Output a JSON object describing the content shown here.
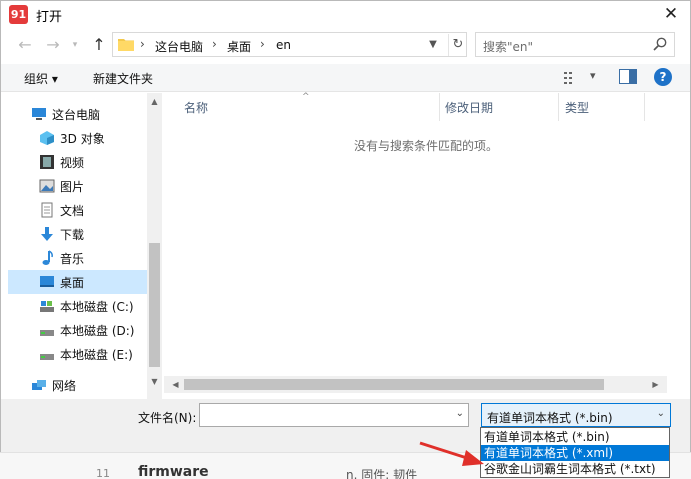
{
  "dialog": {
    "title": "打开",
    "app_icon_text": "91",
    "close_symbol": "✕"
  },
  "address": {
    "crumbs": [
      "这台电脑",
      "桌面",
      "en"
    ],
    "separator": "›"
  },
  "search": {
    "placeholder": "搜索\"en\""
  },
  "toolbar": {
    "organize": "组织 ▾",
    "new_folder": "新建文件夹",
    "view_label": "▾"
  },
  "nav": {
    "items": [
      {
        "label": "这台电脑",
        "icon": "computer-icon"
      },
      {
        "label": "3D 对象",
        "icon": "3d-objects-icon"
      },
      {
        "label": "视频",
        "icon": "video-icon"
      },
      {
        "label": "图片",
        "icon": "pictures-icon"
      },
      {
        "label": "文档",
        "icon": "documents-icon"
      },
      {
        "label": "下载",
        "icon": "download-icon"
      },
      {
        "label": "音乐",
        "icon": "music-icon"
      },
      {
        "label": "桌面",
        "icon": "desktop-icon",
        "selected": true
      },
      {
        "label": "本地磁盘 (C:)",
        "icon": "drive-c-icon"
      },
      {
        "label": "本地磁盘 (D:)",
        "icon": "drive-icon"
      },
      {
        "label": "本地磁盘 (E:)",
        "icon": "drive-icon"
      },
      {
        "label": "网络",
        "icon": "network-icon"
      }
    ]
  },
  "filelist": {
    "columns": [
      "名称",
      "修改日期",
      "类型"
    ],
    "empty_message": "没有与搜索条件匹配的项。"
  },
  "bottom": {
    "filename_label": "文件名(N):",
    "filename_value": "",
    "filetype_selected": "有道单词本格式 (*.bin)",
    "filetype_options": [
      "有道单词本格式 (*.bin)",
      "有道单词本格式 (*.xml)",
      "谷歌金山词霸生词本格式 (*.txt)"
    ],
    "highlighted_option_index": 1
  },
  "background_app": {
    "row_number": "11",
    "row_word": "firmware",
    "row_definition": "n. 固件; 韧件"
  },
  "colors": {
    "accent": "#0078d7",
    "selected_nav": "#cce8ff",
    "arrow_red": "#e0302a"
  }
}
